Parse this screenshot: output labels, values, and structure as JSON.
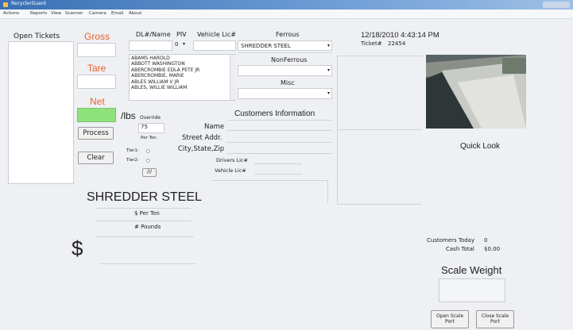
{
  "window": {
    "title": "RecyclerGuard"
  },
  "menu": [
    "Actions",
    "Reports",
    "View",
    "Scanner",
    "Camera",
    "Email",
    "About"
  ],
  "open_tickets": {
    "label": "Open Tickets"
  },
  "weights": {
    "gross_label": "Gross",
    "tare_label": "Tare",
    "net_label": "Net",
    "lbs_label": "/lbs"
  },
  "buttons": {
    "process": "Process",
    "clear": "Clear",
    "small": "///",
    "open_scale": "Open Scale Port",
    "close_scale": "Close Scale Port"
  },
  "fields": {
    "dl_name": "DL#/Name",
    "piv": "PIV",
    "vehicle_lic": "Vehicle Lic#",
    "piv_value": "0"
  },
  "customers": [
    "ABAMS HAROLD",
    "ABBOTT WASHINGTON",
    "ABERCROMBIE EDLA PETE JR",
    "ABERCROMBIE, MARIE",
    "ABLES WILLIAM V JR",
    "ABLES, WILLIE WILLIAM"
  ],
  "materials": {
    "ferrous_label": "Ferrous",
    "ferrous_value": "SHREDDER STEEL",
    "nonferrous_label": "NonFerrous",
    "misc_label": "Misc"
  },
  "pricing": {
    "override_label": "Override",
    "override_value": "75",
    "per_ton_label": "Per Ton",
    "tier1": "Tier1:",
    "tier2": "Tier2:"
  },
  "customer_info": {
    "header": "Customers Information",
    "name": "Name",
    "street": "Street Addr.",
    "city": "City,State,Zip",
    "drivers_lic": "Drivers Lic#",
    "vehicle_lic": "Vehicle Lic#"
  },
  "summary": {
    "material": "SHREDDER STEEL",
    "per_ton": "$ Per Ton",
    "pounds": "# Pounds",
    "dollar": "$"
  },
  "datetime": "12/18/2010 4:43:14 PM",
  "ticket": {
    "label": "Ticket#",
    "value": "22454"
  },
  "quick_look": "Quick Look",
  "stats": {
    "customers_today_label": "Customers Today",
    "customers_today": "0",
    "cash_total_label": "Cash Total",
    "cash_total": "$0.00"
  },
  "scale": {
    "label": "Scale Weight"
  },
  "colors": {
    "net_box": "#8fe27a",
    "orange": "#e9622a"
  }
}
